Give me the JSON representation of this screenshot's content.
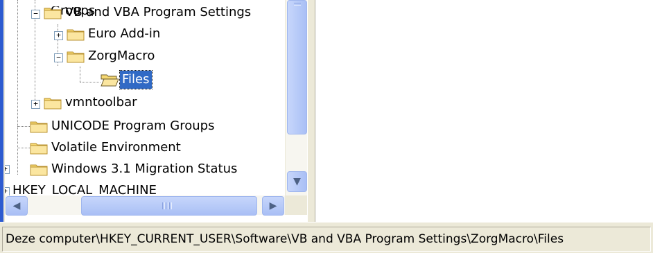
{
  "tree": {
    "items": [
      {
        "label": "Program Groups",
        "state": "collapsed"
      },
      {
        "label": "VB and VBA Program Settings",
        "state": "expanded"
      },
      {
        "label": "Euro Add-in",
        "state": "collapsed"
      },
      {
        "label": "ZorgMacro",
        "state": "expanded"
      },
      {
        "label": "Files",
        "state": "selected"
      },
      {
        "label": "vmntoolbar",
        "state": "collapsed"
      },
      {
        "label": "UNICODE Program Groups",
        "state": "leaf"
      },
      {
        "label": "Volatile Environment",
        "state": "leaf"
      },
      {
        "label": "Windows 3.1 Migration Status",
        "state": "collapsed"
      },
      {
        "label": "HKEY_LOCAL_MACHINE",
        "state": "collapsed"
      }
    ]
  },
  "statusbar": {
    "path": "Deze computer\\HKEY_CURRENT_USER\\Software\\VB and VBA Program Settings\\ZorgMacro\\Files"
  },
  "icons": {
    "expand": "plus-box",
    "collapse": "minus-box",
    "folder": "folder-icon",
    "folder_open": "open-folder-icon",
    "scroll_up": "chevron-up",
    "scroll_down": "chevron-down",
    "scroll_left": "chevron-left",
    "scroll_right": "chevron-right"
  },
  "colors": {
    "selection": "#316ac5",
    "folder": "#f6d872",
    "scrollbar": "#b8cbf8"
  }
}
